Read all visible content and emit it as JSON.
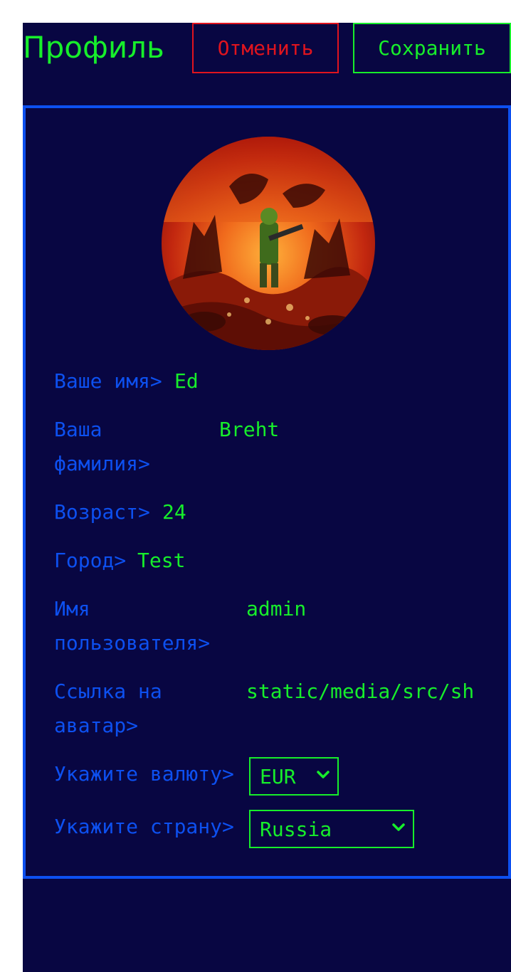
{
  "header": {
    "title": "Профиль",
    "cancel_label": "Отменить",
    "save_label": "Сохранить"
  },
  "profile": {
    "avatar_icon": "avatar-image",
    "fields": {
      "first_name": {
        "label": "Ваше имя>",
        "value": "Ed"
      },
      "last_name": {
        "label": "Ваша\nфамилия>",
        "value": "Breht"
      },
      "age": {
        "label": "Возраст>",
        "value": "24"
      },
      "city": {
        "label": "Город>",
        "value": "Test"
      },
      "username": {
        "label": "Имя\nпользователя>",
        "value": "admin"
      },
      "avatar_link": {
        "label": "Ссылка на\nаватар>",
        "value": "static/media/src/sh"
      }
    },
    "currency": {
      "label": "Укажите валюту>",
      "selected": "EUR"
    },
    "country": {
      "label": "Укажите страну>",
      "selected": "Russia"
    }
  },
  "colors": {
    "background": "#080642",
    "accent_green": "#17ee2b",
    "accent_blue": "#0d50f0",
    "danger_red": "#e0141e"
  }
}
